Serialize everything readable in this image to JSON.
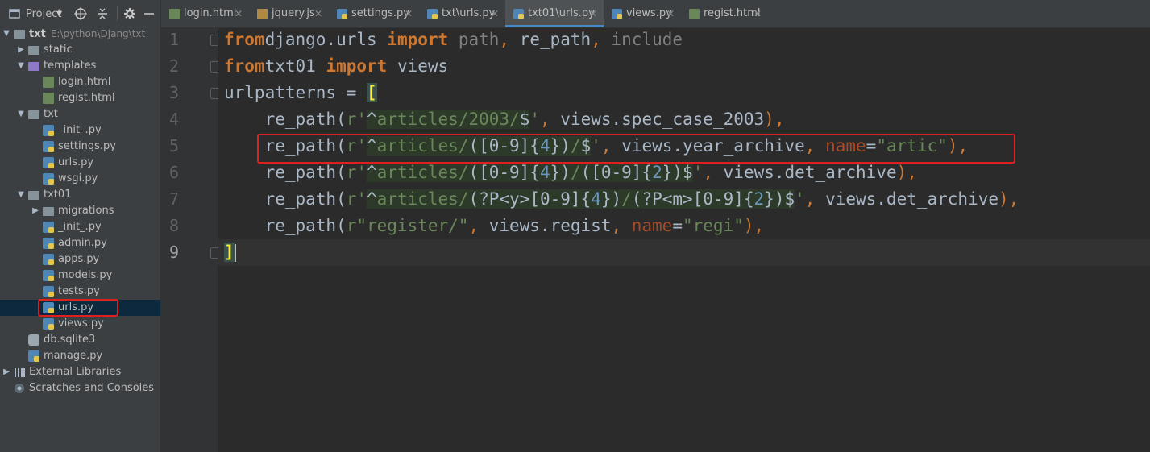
{
  "project_panel": {
    "title": "Project",
    "tree": [
      {
        "label": "txt",
        "path": "E:\\python\\Djang\\txt",
        "type": "folder",
        "depth": 0,
        "expanded": true,
        "bold": true
      },
      {
        "label": "static",
        "type": "folder",
        "depth": 1,
        "expanded": false
      },
      {
        "label": "templates",
        "type": "folder-purple",
        "depth": 1,
        "expanded": true
      },
      {
        "label": "login.html",
        "type": "html",
        "depth": 2
      },
      {
        "label": "regist.html",
        "type": "html",
        "depth": 2
      },
      {
        "label": "txt",
        "type": "folder",
        "depth": 1,
        "expanded": true
      },
      {
        "label": "_init_.py",
        "type": "py",
        "depth": 2
      },
      {
        "label": "settings.py",
        "type": "py",
        "depth": 2
      },
      {
        "label": "urls.py",
        "type": "py",
        "depth": 2
      },
      {
        "label": "wsgi.py",
        "type": "py",
        "depth": 2
      },
      {
        "label": "txt01",
        "type": "folder",
        "depth": 1,
        "expanded": true
      },
      {
        "label": "migrations",
        "type": "folder",
        "depth": 2,
        "expanded": false
      },
      {
        "label": "_init_.py",
        "type": "py",
        "depth": 2
      },
      {
        "label": "admin.py",
        "type": "py",
        "depth": 2
      },
      {
        "label": "apps.py",
        "type": "py",
        "depth": 2
      },
      {
        "label": "models.py",
        "type": "py",
        "depth": 2
      },
      {
        "label": "tests.py",
        "type": "py",
        "depth": 2
      },
      {
        "label": "urls.py",
        "type": "py",
        "depth": 2,
        "selected": true,
        "highlighted": true
      },
      {
        "label": "views.py",
        "type": "py",
        "depth": 2
      },
      {
        "label": "db.sqlite3",
        "type": "db",
        "depth": 1
      },
      {
        "label": "manage.py",
        "type": "py",
        "depth": 1
      },
      {
        "label": "External Libraries",
        "type": "lib",
        "depth": 0,
        "expanded": false
      },
      {
        "label": "Scratches and Consoles",
        "type": "scratch",
        "depth": 0
      }
    ]
  },
  "tabs": [
    {
      "label": "login.html",
      "type": "html"
    },
    {
      "label": "jquery.js",
      "type": "js"
    },
    {
      "label": "settings.py",
      "type": "py"
    },
    {
      "label": "txt\\urls.py",
      "type": "py"
    },
    {
      "label": "txt01\\urls.py",
      "type": "py",
      "active": true
    },
    {
      "label": "views.py",
      "type": "py"
    },
    {
      "label": "regist.html",
      "type": "html"
    }
  ],
  "editor": {
    "current_line": 9,
    "highlighted_line": 5,
    "lines": [
      {
        "num": "1",
        "tokens": [
          [
            "kw",
            "from"
          ],
          [
            "",
            "django.urls "
          ],
          [
            "kw",
            "import "
          ],
          [
            "dim",
            "path"
          ],
          [
            "par",
            ", "
          ],
          [
            "",
            "re_path"
          ],
          [
            "par",
            ", "
          ],
          [
            "dim",
            "include"
          ]
        ]
      },
      {
        "num": "2",
        "tokens": [
          [
            "kw",
            "from"
          ],
          [
            "",
            "txt01 "
          ],
          [
            "kw",
            "import "
          ],
          [
            "",
            "views"
          ]
        ]
      },
      {
        "num": "3",
        "tokens": [
          [
            "",
            "urlpatterns = "
          ],
          [
            "brk",
            "["
          ]
        ]
      },
      {
        "num": "4",
        "tokens": [
          [
            "",
            "    re_path("
          ],
          [
            "str",
            "r'"
          ],
          [
            "reop",
            "^"
          ],
          [
            "re",
            "articles/2003/"
          ],
          [
            "reop",
            "$"
          ],
          [
            "str",
            "'"
          ],
          [
            "par",
            ", "
          ],
          [
            "",
            "views.spec_case_2003"
          ],
          [
            "par",
            "),"
          ]
        ]
      },
      {
        "num": "5",
        "tokens": [
          [
            "",
            "    re_path("
          ],
          [
            "str",
            "r'"
          ],
          [
            "reop",
            "^"
          ],
          [
            "re",
            "articles/"
          ],
          [
            "reop",
            "([0-9]{"
          ],
          [
            "num",
            "4"
          ],
          [
            "reop",
            "})"
          ],
          [
            "re",
            "/"
          ],
          [
            "reop",
            "$"
          ],
          [
            "str",
            "'"
          ],
          [
            "par",
            ", "
          ],
          [
            "",
            "views.year_archive"
          ],
          [
            "par",
            ", "
          ],
          [
            "kwarg",
            "name"
          ],
          [
            "",
            "="
          ],
          [
            "str",
            "\"artic\""
          ],
          [
            "par",
            "),"
          ]
        ]
      },
      {
        "num": "6",
        "tokens": [
          [
            "",
            "    re_path("
          ],
          [
            "str",
            "r'"
          ],
          [
            "reop",
            "^"
          ],
          [
            "re",
            "articles/"
          ],
          [
            "reop",
            "([0-9]{"
          ],
          [
            "num",
            "4"
          ],
          [
            "reop",
            "})"
          ],
          [
            "re",
            "/"
          ],
          [
            "reop",
            "([0-9]{"
          ],
          [
            "num",
            "2"
          ],
          [
            "reop",
            "})$"
          ],
          [
            "str",
            "'"
          ],
          [
            "par",
            ", "
          ],
          [
            "",
            "views.det_archive"
          ],
          [
            "par",
            "),"
          ]
        ]
      },
      {
        "num": "7",
        "tokens": [
          [
            "",
            "    re_path("
          ],
          [
            "str",
            "r'"
          ],
          [
            "reop",
            "^"
          ],
          [
            "re",
            "articles/"
          ],
          [
            "reop",
            "(?P<y>[0-9]{"
          ],
          [
            "num",
            "4"
          ],
          [
            "reop",
            "})"
          ],
          [
            "re",
            "/"
          ],
          [
            "reop",
            "(?P<m>[0-9]{"
          ],
          [
            "num",
            "2"
          ],
          [
            "reop",
            "})$"
          ],
          [
            "str",
            "'"
          ],
          [
            "par",
            ", "
          ],
          [
            "",
            "views.det_archive"
          ],
          [
            "par",
            "),"
          ]
        ]
      },
      {
        "num": "8",
        "tokens": [
          [
            "",
            "    re_path("
          ],
          [
            "str",
            "r\"register/\""
          ],
          [
            "par",
            ", "
          ],
          [
            "",
            "views.regist"
          ],
          [
            "par",
            ", "
          ],
          [
            "kwarg",
            "name"
          ],
          [
            "",
            "="
          ],
          [
            "str",
            "\"regi\""
          ],
          [
            "par",
            "),"
          ]
        ]
      },
      {
        "num": "9",
        "tokens": [
          [
            "brk",
            "]"
          ]
        ]
      }
    ]
  },
  "colors": {
    "highlight_box": "#e0201f",
    "keyword": "#cc7832",
    "string": "#6a8759",
    "number": "#6897bb",
    "selection": "#0d293e"
  }
}
